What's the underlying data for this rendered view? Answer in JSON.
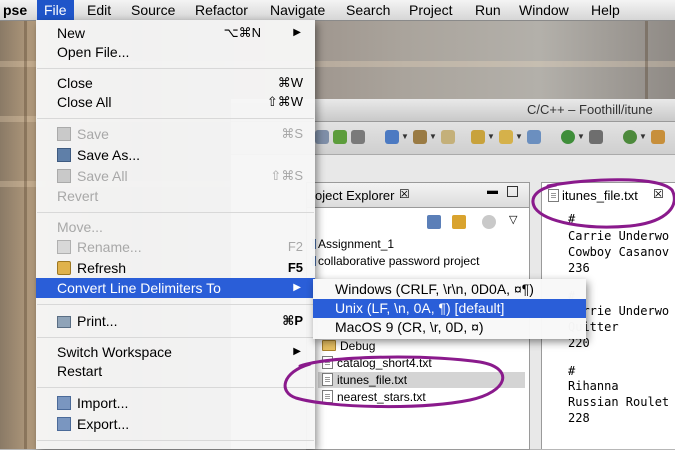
{
  "menubar": {
    "app": "pse",
    "items": [
      "File",
      "Edit",
      "Source",
      "Refactor",
      "Navigate",
      "Search",
      "Project",
      "Run",
      "Window",
      "Help"
    ]
  },
  "window": {
    "title": "C/C++ – Foothill/itune"
  },
  "explorer": {
    "tab_label": "oject Explorer",
    "close_glyph": "☒",
    "items": [
      {
        "label": "Assignment_1",
        "kind": "project"
      },
      {
        "label": "collaborative password project",
        "kind": "project"
      },
      {
        "label": "Debug",
        "kind": "folder"
      },
      {
        "label": "catalog_short4.txt",
        "kind": "file"
      },
      {
        "label": "itunes_file.txt",
        "kind": "file"
      },
      {
        "label": "nearest_stars.txt",
        "kind": "file"
      }
    ]
  },
  "editor": {
    "tab_label": "itunes_file.txt",
    "close_glyph": "☒",
    "lines": [
      "#",
      "Carrie Underwo",
      "Cowboy Casanov",
      "236",
      "",
      "#",
      "Carrie Underwo",
      "Quitter",
      "220",
      "",
      "#",
      "Rihanna",
      "Russian Roulet",
      "228"
    ]
  },
  "filemenu": {
    "items": [
      {
        "label": "New",
        "shortcut": "⌥⌘N",
        "submenu": true
      },
      {
        "label": "Open File..."
      },
      {
        "label": "Close",
        "shortcut": "⌘W"
      },
      {
        "label": "Close All",
        "shortcut": "⇧⌘W"
      },
      {
        "label": "Save",
        "shortcut": "⌘S",
        "disabled": true,
        "icon": "save-icon"
      },
      {
        "label": "Save As...",
        "icon": "save-as-icon"
      },
      {
        "label": "Save All",
        "shortcut": "⇧⌘S",
        "disabled": true,
        "icon": "save-all-icon"
      },
      {
        "label": "Revert",
        "disabled": true
      },
      {
        "label": "Move...",
        "disabled": true
      },
      {
        "label": "Rename...",
        "shortcut": "F2",
        "disabled": true,
        "icon": "rename-icon"
      },
      {
        "label": "Refresh",
        "shortcut": "F5",
        "icon": "refresh-icon"
      },
      {
        "label": "Convert Line Delimiters To",
        "submenu": true,
        "highlighted": true
      },
      {
        "label": "Print...",
        "shortcut": "⌘P",
        "icon": "print-icon"
      },
      {
        "label": "Switch Workspace",
        "submenu": true
      },
      {
        "label": "Restart"
      },
      {
        "label": "Import...",
        "icon": "import-icon"
      },
      {
        "label": "Export...",
        "icon": "export-icon"
      }
    ]
  },
  "submenu": {
    "items": [
      {
        "label": "Windows (CRLF, \\r\\n, 0D0A, ¤¶)"
      },
      {
        "label": "Unix (LF, \\n, 0A, ¶) [default]",
        "highlighted": true
      },
      {
        "label": "MacOS 9 (CR, \\r, 0D, ¤)"
      }
    ]
  },
  "colors": {
    "highlight": "#2a5ed8",
    "annotation": "#8a1a8c"
  }
}
